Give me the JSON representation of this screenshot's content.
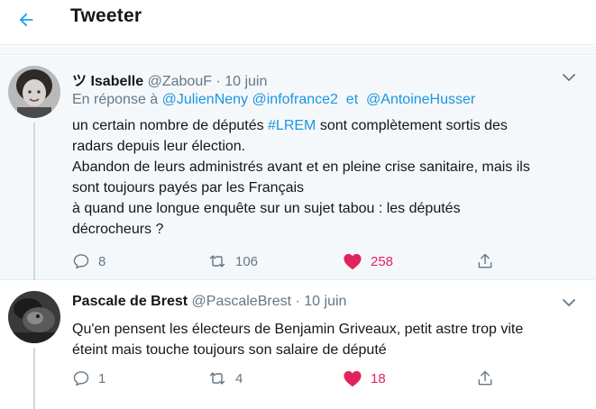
{
  "header": {
    "title": "Tweeter",
    "back_icon": "arrow-left-icon",
    "accent": "#1da1f2"
  },
  "tweets": [
    {
      "display_name": "ツ Isabelle",
      "handle": "@ZabouF",
      "separator": "·",
      "date": "10 juin",
      "reply_prefix": "En réponse à",
      "mentions": [
        "@JulienNeny",
        "@infofrance2",
        "et",
        "@AntoineHusser"
      ],
      "text": {
        "line1_before": "un certain nombre de députés ",
        "line1_hashtag": "#LREM",
        "line1_after": " sont complètement sortis des",
        "line2": "radars depuis leur élection.",
        "line3": "Abandon de leurs administrés avant et en pleine crise sanitaire, mais ils",
        "line4": "sont toujours payés par les Français",
        "line5": "à quand une longue enquête sur un sujet tabou : les députés",
        "line6": "décrocheurs ?"
      },
      "replies": "8",
      "retweets": "106",
      "likes": "258",
      "liked": true
    },
    {
      "display_name": "Pascale de Brest",
      "handle": "@PascaleBrest",
      "separator": "·",
      "date": "10 juin",
      "text": {
        "line1": "Qu'en pensent les électeurs de Benjamin Griveaux, petit astre trop vite",
        "line2": "éteint mais touche toujours son salaire de député"
      },
      "replies": "1",
      "retweets": "4",
      "likes": "18",
      "liked": true
    }
  ],
  "colors": {
    "link": "#1b95e0",
    "muted": "#657786",
    "like": "#e0245e",
    "divider": "#e6ecf0"
  }
}
